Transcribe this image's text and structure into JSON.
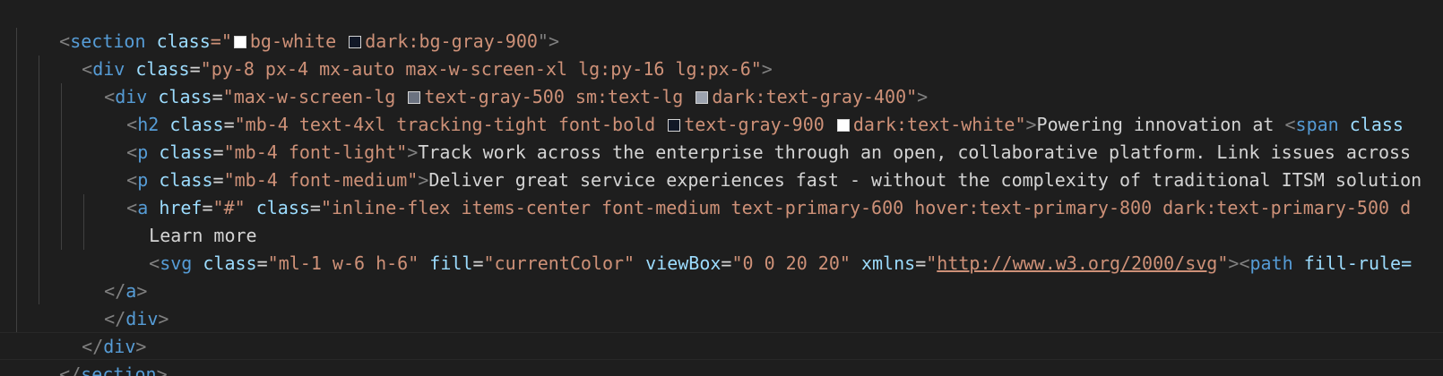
{
  "code": {
    "l1": {
      "open": "<",
      "tag": "section",
      "attr": "class",
      "eq": "=\"",
      "v1": "bg-white",
      "v2": "dark:bg-gray-900",
      "end": "\">",
      "c1": "#ffffff",
      "c2": "#111827"
    },
    "l2": {
      "open": "<",
      "tag": "div",
      "attr": "class",
      "eq": "=",
      "value": "\"py-8 px-4 mx-auto max-w-screen-xl lg:py-16 lg:px-6\"",
      "end": ">"
    },
    "l3": {
      "open": "<",
      "tag": "div",
      "attr": "class",
      "eq": "=",
      "v0": "\"max-w-screen-lg ",
      "v1": "text-gray-500 sm:text-lg ",
      "v2": "dark:text-gray-400\"",
      "end": ">",
      "c1": "#6b7280",
      "c2": "#9ca3af"
    },
    "l4": {
      "open": "<",
      "tag": "h2",
      "attr": "class",
      "eq": "=",
      "v0": "\"mb-4 text-4xl tracking-tight font-bold ",
      "v1": "text-gray-900 ",
      "v2": "dark:text-white\"",
      "end": ">",
      "text": "Powering innovation at ",
      "open2": "<",
      "tag2": "span",
      "attr2": "class",
      "c1": "#111827",
      "c2": "#ffffff"
    },
    "l5": {
      "open": "<",
      "tag": "p",
      "attr": "class",
      "eq": "=",
      "value": "\"mb-4 font-light\"",
      "end": ">",
      "text": "Track work across the enterprise through an open, collaborative platform. Link issues across"
    },
    "l6": {
      "open": "<",
      "tag": "p",
      "attr": "class",
      "eq": "=",
      "value": "\"mb-4 font-medium\"",
      "end": ">",
      "text": "Deliver great service experiences fast - without the complexity of traditional ITSM solution"
    },
    "l7": {
      "open": "<",
      "tag": "a",
      "attr": "href",
      "eq": "=",
      "value": "\"#\"",
      "attr2": "class",
      "eq2": "=",
      "value2": "\"inline-flex items-center font-medium text-primary-600 hover:text-primary-800 dark:text-primary-500 d"
    },
    "l8": {
      "text": "Learn more"
    },
    "l9": {
      "open": "<",
      "tag": "svg",
      "attr1": "class",
      "val1": "\"ml-1 w-6 h-6\"",
      "attr2": "fill",
      "val2": "\"currentColor\"",
      "attr3": "viewBox",
      "val3": "\"0 0 20 20\"",
      "attr4": "xmlns",
      "q1": "\"",
      "url": "http://www.w3.org/2000/svg",
      "q2": "\"",
      "close": "><",
      "tag2": "path",
      "attr5": "fill-rule="
    },
    "l10": {
      "open": "</",
      "tag": "a",
      "end": ">"
    },
    "l11": {
      "open": "</",
      "tag": "div",
      "end": ">"
    },
    "l12": {
      "open": "</",
      "tag": "div",
      "end": ">"
    },
    "l13": {
      "open": "</",
      "tag": "section",
      "end": ">"
    }
  }
}
